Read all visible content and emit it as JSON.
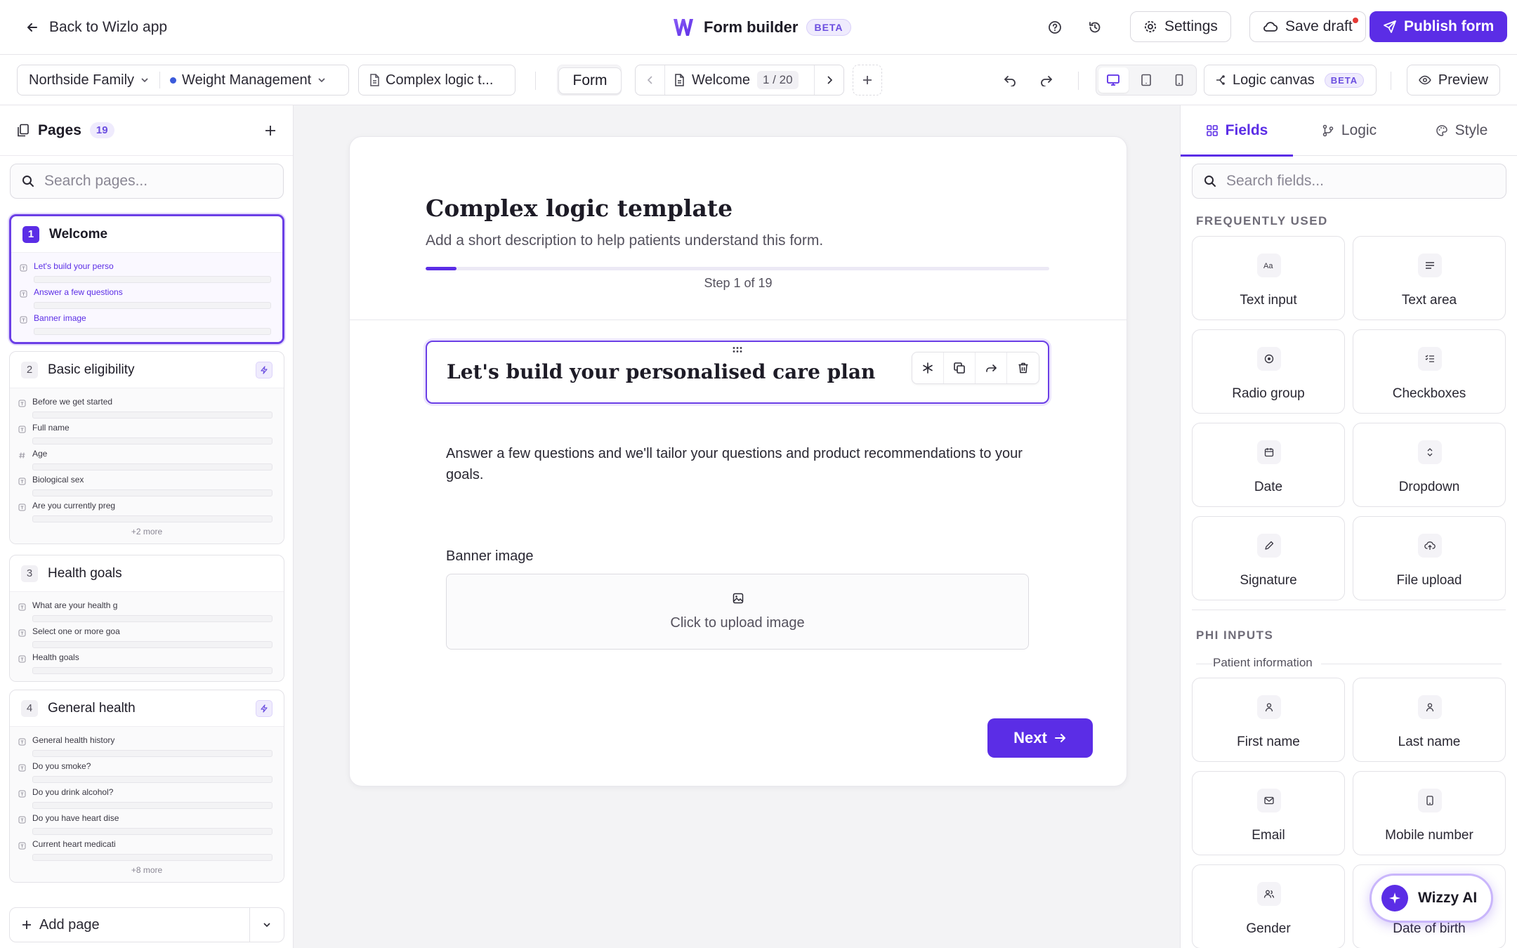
{
  "topbar": {
    "back_label": "Back to Wizlo app",
    "title": "Form builder",
    "beta": "BETA",
    "settings_label": "Settings",
    "save_draft_label": "Save draft",
    "publish_label": "Publish form",
    "accent": "#5b2de6"
  },
  "toolbar": {
    "org": "Northside Family",
    "program": "Weight Management",
    "template": "Complex logic t...",
    "form_tab": "Form",
    "page_name": "Welcome",
    "page_counter": "1 / 20",
    "logic_canvas_label": "Logic canvas",
    "logic_beta": "BETA",
    "preview_label": "Preview"
  },
  "pages": {
    "title": "Pages",
    "count": "19",
    "search_placeholder": "Search pages...",
    "add_page_label": "Add page",
    "items": [
      {
        "num": "1",
        "title": "Welcome",
        "active": true,
        "logic": false,
        "fields": [
          {
            "label": "Let's build your perso",
            "icon": "text"
          },
          {
            "label": "Answer a few questions",
            "icon": "text"
          },
          {
            "label": "Banner image",
            "icon": "text"
          }
        ],
        "more": ""
      },
      {
        "num": "2",
        "title": "Basic eligibility",
        "active": false,
        "logic": true,
        "fields": [
          {
            "label": "Before we get started",
            "icon": "text"
          },
          {
            "label": "Full name",
            "icon": "text"
          },
          {
            "label": "Age",
            "icon": "hash"
          },
          {
            "label": "Biological sex",
            "icon": "text"
          },
          {
            "label": "Are you currently preg",
            "icon": "text"
          }
        ],
        "more": "+2 more"
      },
      {
        "num": "3",
        "title": "Health goals",
        "active": false,
        "logic": false,
        "fields": [
          {
            "label": "What are your health g",
            "icon": "text"
          },
          {
            "label": "Select one or more goa",
            "icon": "text"
          },
          {
            "label": "Health goals",
            "icon": "text"
          }
        ],
        "more": ""
      },
      {
        "num": "4",
        "title": "General health",
        "active": false,
        "logic": true,
        "fields": [
          {
            "label": "General health history",
            "icon": "text"
          },
          {
            "label": "Do you smoke?",
            "icon": "text"
          },
          {
            "label": "Do you drink alcohol?",
            "icon": "text"
          },
          {
            "label": "Do you have heart dise",
            "icon": "text"
          },
          {
            "label": "Current heart medicati",
            "icon": "text"
          }
        ],
        "more": "+8 more"
      }
    ]
  },
  "form": {
    "title": "Complex logic template",
    "description": "Add a short description to help patients understand this form.",
    "step_label": "Step 1 of 19",
    "progress": 0.05,
    "heading": "Let's build your personalised care plan",
    "paragraph": "Answer a few questions and we'll tailor your questions and product recommendations to your goals.",
    "banner_label": "Banner image",
    "upload_text": "Click to upload image",
    "next_label": "Next"
  },
  "fields_panel": {
    "tabs": [
      "Fields",
      "Logic",
      "Style"
    ],
    "search_placeholder": "Search fields...",
    "frequently_used_label": "FREQUENTLY USED",
    "frequently_used": [
      {
        "label": "Text input",
        "icon": "text-input-icon"
      },
      {
        "label": "Text area",
        "icon": "text-area-icon"
      },
      {
        "label": "Radio group",
        "icon": "radio-icon"
      },
      {
        "label": "Checkboxes",
        "icon": "checklist-icon"
      },
      {
        "label": "Date",
        "icon": "calendar-icon"
      },
      {
        "label": "Dropdown",
        "icon": "dropdown-icon"
      },
      {
        "label": "Signature",
        "icon": "pen-icon"
      },
      {
        "label": "File upload",
        "icon": "cloud-upload-icon"
      }
    ],
    "phi_label": "PHI INPUTS",
    "patient_info_label": "Patient information",
    "phi_inputs": [
      {
        "label": "First name",
        "icon": "user-icon"
      },
      {
        "label": "Last name",
        "icon": "user-icon"
      },
      {
        "label": "Email",
        "icon": "mail-icon"
      },
      {
        "label": "Mobile number",
        "icon": "phone-icon"
      },
      {
        "label": "Gender",
        "icon": "users-icon"
      },
      {
        "label": "Date of birth",
        "icon": "calendar-icon"
      }
    ]
  },
  "wizzy": {
    "label": "Wizzy AI"
  }
}
